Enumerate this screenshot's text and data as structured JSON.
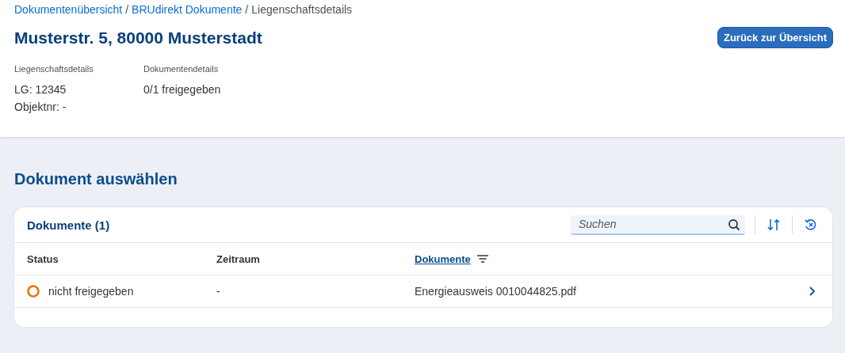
{
  "breadcrumbs": [
    {
      "label": "Dokumentenübersicht",
      "link": true
    },
    {
      "label": "BRUdirekt Dokumente",
      "link": true
    },
    {
      "label": "Liegenschaftsdetails",
      "link": false
    }
  ],
  "separator": "/",
  "title": "Musterstr. 5, 80000 Musterstadt",
  "back_button": "Zurück zur Übersicht",
  "details": [
    {
      "heading": "Liegenschaftsdetails",
      "values": [
        "LG: 12345",
        "Objektnr: -"
      ]
    },
    {
      "heading": "Dokumentendetails",
      "values": [
        "0/1 freigegeben"
      ]
    }
  ],
  "section_title": "Dokument auswählen",
  "table": {
    "title": "Dokumente (1)",
    "search": {
      "placeholder": "Suchen"
    },
    "columns": [
      {
        "label": "Status",
        "filtered": false
      },
      {
        "label": "Zeitraum",
        "filtered": false
      },
      {
        "label": "Dokumente",
        "filtered": true
      }
    ],
    "rows": [
      {
        "status": "nicht freigegeben",
        "color": "#e9730c",
        "zeitraum": "-",
        "dokument": "Energieausweis 0010044825.pdf"
      }
    ]
  }
}
